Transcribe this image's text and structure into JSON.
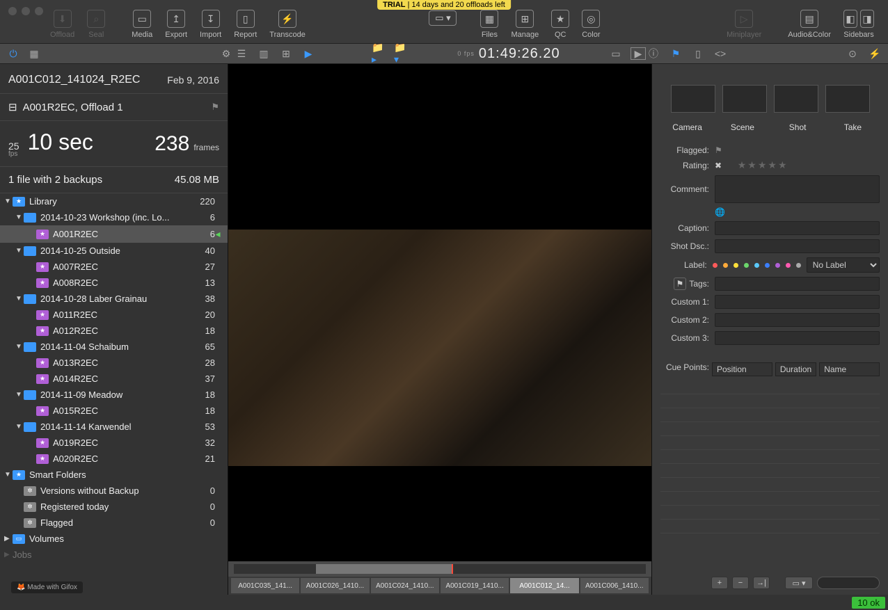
{
  "trial": {
    "label": "TRIAL",
    "text": "14 days and 20 offloads left"
  },
  "toolbar": {
    "offload": "Offload",
    "seal": "Seal",
    "media": "Media",
    "export": "Export",
    "import": "Import",
    "report": "Report",
    "transcode": "Transcode",
    "files": "Files",
    "manage": "Manage",
    "qc": "QC",
    "color": "Color",
    "miniplayer": "Miniplayer",
    "audiocolor": "Audio&Color",
    "sidebars": "Sidebars"
  },
  "timecode": {
    "fps_label": "0 fps",
    "value": "01:49:26.20"
  },
  "clip": {
    "name": "A001C012_141024_R2EC",
    "date": "Feb 9, 2016",
    "offload": "A001R2EC, Offload 1",
    "fps": "25",
    "fps_label": "fps",
    "duration": "10 sec",
    "frames": "238",
    "frames_label": "frames",
    "file_info": "1 file with 2 backups",
    "size": "45.08 MB"
  },
  "library": {
    "root": {
      "label": "Library",
      "count": "220"
    },
    "folders": [
      {
        "label": "2014-10-23 Workshop (inc. Lo...",
        "count": "6",
        "indent": 1,
        "type": "folder",
        "expanded": true
      },
      {
        "label": "A001R2EC",
        "count": "6",
        "indent": 2,
        "type": "star",
        "selected": true,
        "mark": true
      },
      {
        "label": "2014-10-25 Outside",
        "count": "40",
        "indent": 1,
        "type": "folder",
        "expanded": true
      },
      {
        "label": "A007R2EC",
        "count": "27",
        "indent": 2,
        "type": "star",
        "tick": true
      },
      {
        "label": "A008R2EC",
        "count": "13",
        "indent": 2,
        "type": "star",
        "tick": true
      },
      {
        "label": "2014-10-28 Laber Grainau",
        "count": "38",
        "indent": 1,
        "type": "folder",
        "expanded": true
      },
      {
        "label": "A011R2EC",
        "count": "20",
        "indent": 2,
        "type": "star"
      },
      {
        "label": "A012R2EC",
        "count": "18",
        "indent": 2,
        "type": "star"
      },
      {
        "label": "2014-11-04 Schaibum",
        "count": "65",
        "indent": 1,
        "type": "folder",
        "expanded": true
      },
      {
        "label": "A013R2EC",
        "count": "28",
        "indent": 2,
        "type": "star"
      },
      {
        "label": "A014R2EC",
        "count": "37",
        "indent": 2,
        "type": "star"
      },
      {
        "label": "2014-11-09 Meadow",
        "count": "18",
        "indent": 1,
        "type": "folder",
        "expanded": true
      },
      {
        "label": "A015R2EC",
        "count": "18",
        "indent": 2,
        "type": "star"
      },
      {
        "label": "2014-11-14 Karwendel",
        "count": "53",
        "indent": 1,
        "type": "folder",
        "expanded": true
      },
      {
        "label": "A019R2EC",
        "count": "32",
        "indent": 2,
        "type": "star"
      },
      {
        "label": "A020R2EC",
        "count": "21",
        "indent": 2,
        "type": "star"
      }
    ],
    "smart_root": "Smart Folders",
    "smart": [
      {
        "label": "Versions without Backup",
        "count": "0"
      },
      {
        "label": "Registered today",
        "count": "0"
      },
      {
        "label": "Flagged",
        "count": "0"
      }
    ],
    "volumes": "Volumes",
    "jobs": "Jobs"
  },
  "thumbs": [
    "A001C035_141...",
    "A001C026_1410...",
    "A001C024_1410...",
    "A001C019_1410...",
    "A001C012_14...",
    "A001C006_1410..."
  ],
  "thumbs_active": 4,
  "meta": {
    "tabs": [
      "Camera",
      "Scene",
      "Shot",
      "Take"
    ],
    "flagged": "Flagged:",
    "rating": "Rating:",
    "comment": "Comment:",
    "caption": "Caption:",
    "shotdsc": "Shot Dsc.:",
    "label": "Label:",
    "label_value": "No Label",
    "tags": "Tags:",
    "custom1": "Custom 1:",
    "custom2": "Custom 2:",
    "custom3": "Custom 3:",
    "cuepoints": "Cue Points:",
    "cue_cols": [
      "Position",
      "Duration",
      "Name"
    ],
    "label_colors": [
      "#ff5a5a",
      "#ffaa3a",
      "#ffe03a",
      "#6bd66b",
      "#5ac8fa",
      "#3b7ffc",
      "#b05fd6",
      "#ff5ab0",
      "#aaa"
    ]
  },
  "status": {
    "ok": "10 ok"
  },
  "gifox": "Made with Gifox"
}
